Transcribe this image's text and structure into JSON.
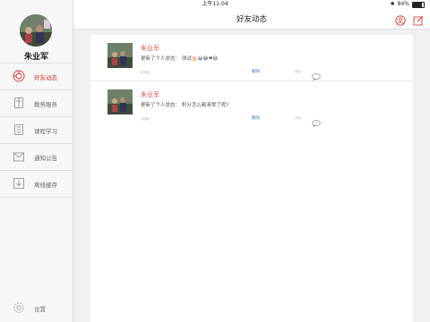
{
  "status_bar": {
    "device": "iPad",
    "time": "上午11:04",
    "battery": "84%"
  },
  "sidebar": {
    "username": "朱业军",
    "items": [
      {
        "label": "好友动态",
        "icon": "friends-feed-icon",
        "active": true
      },
      {
        "label": "教务服务",
        "icon": "book-icon",
        "active": false
      },
      {
        "label": "课程学习",
        "icon": "courseware-icon",
        "active": false
      },
      {
        "label": "通知公告",
        "icon": "envelope-icon",
        "active": false
      },
      {
        "label": "离线缓存",
        "icon": "download-icon",
        "active": false
      }
    ],
    "settings_label": "设置"
  },
  "header": {
    "title": "好友动态",
    "icons": [
      "person-circle-icon",
      "compose-icon"
    ]
  },
  "posts": [
    {
      "name": "朱业军",
      "text": "更新了个人状态：  测试",
      "emoji": "🎂😀😂❤😅",
      "time": "8分前",
      "delete_label": "删除",
      "comment_label": "评论"
    },
    {
      "name": "朱业军",
      "text": "更新了个人状态：  积分怎么都清零了呢?",
      "time": "1天前",
      "delete_label": "删除",
      "comment_label": "评论"
    }
  ],
  "colors": {
    "accent": "#dd3333",
    "link": "#4a7bb7"
  }
}
